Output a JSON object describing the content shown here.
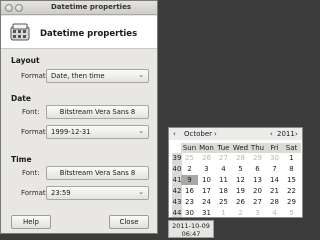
{
  "window": {
    "title": "Datetime properties",
    "header_title": "Datetime properties",
    "layout_section": "Layout",
    "layout_format_label": "Format:",
    "layout_format_value": "Date, then time",
    "date_section": "Date",
    "date_font_label": "Font:",
    "date_font_value": "Bitstream Vera Sans 8",
    "date_format_label": "Format:",
    "date_format_value": "1999-12-31",
    "time_section": "Time",
    "time_font_label": "Font:",
    "time_font_value": "Bitstream Vera Sans 8",
    "time_format_label": "Format:",
    "time_format_value": "23:59",
    "help_label": "Help",
    "close_label": "Close",
    "dropdown_icon": "chevron-down-icon"
  },
  "calendar": {
    "prev_month": "‹",
    "month": "October",
    "next_month": "›",
    "prev_year": "‹",
    "year": "2011",
    "next_year": "›",
    "day_names": [
      "Sun",
      "Mon",
      "Tue",
      "Wed",
      "Thu",
      "Fri",
      "Sat"
    ],
    "week_numbers": [
      "39",
      "40",
      "41",
      "42",
      "43",
      "44"
    ],
    "weeks": [
      [
        "25",
        "26",
        "27",
        "28",
        "29",
        "30",
        "1"
      ],
      [
        "2",
        "3",
        "4",
        "5",
        "6",
        "7",
        "8"
      ],
      [
        "9",
        "10",
        "11",
        "12",
        "13",
        "14",
        "15"
      ],
      [
        "16",
        "17",
        "18",
        "19",
        "20",
        "21",
        "22"
      ],
      [
        "23",
        "24",
        "25",
        "26",
        "27",
        "28",
        "29"
      ],
      [
        "30",
        "31",
        "1",
        "2",
        "3",
        "4",
        "5"
      ]
    ],
    "other_month_cells": [
      [
        0,
        0
      ],
      [
        0,
        1
      ],
      [
        0,
        2
      ],
      [
        0,
        3
      ],
      [
        0,
        4
      ],
      [
        0,
        5
      ],
      [
        5,
        2
      ],
      [
        5,
        3
      ],
      [
        5,
        4
      ],
      [
        5,
        5
      ],
      [
        5,
        6
      ]
    ],
    "selected_cell": [
      2,
      0
    ]
  },
  "clock": {
    "date": "2011-10-09",
    "time": "06:47"
  }
}
